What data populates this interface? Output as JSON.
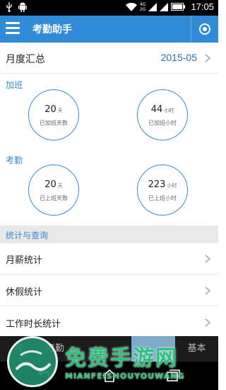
{
  "status_bar": {
    "network_labels": [
      "4G",
      "2G"
    ],
    "time": "17:05"
  },
  "app_bar": {
    "title": "考勤助手"
  },
  "month_summary": {
    "label": "月度汇总",
    "value": "2015-05"
  },
  "overtime": {
    "section_label": "加班",
    "days": {
      "value": "20",
      "unit": "天",
      "caption": "已加班天数"
    },
    "hours": {
      "value": "44",
      "unit": "小时",
      "caption": "已加班小时"
    }
  },
  "attendance": {
    "section_label": "考勤",
    "days": {
      "value": "20",
      "unit": "天",
      "caption": "已上班天数"
    },
    "hours": {
      "value": "223",
      "unit": "小时",
      "caption": "已上班小时"
    }
  },
  "stats": {
    "header": "统计与查询",
    "items": [
      {
        "label": "月薪统计"
      },
      {
        "label": "休假统计"
      },
      {
        "label": "工作时长统计"
      }
    ]
  },
  "tab_bar": {
    "tabs": [
      "打",
      "考勤",
      "",
      "",
      "",
      "基本"
    ]
  },
  "watermark": {
    "title": "免费手游网",
    "subtitle": "MIANFEISHOUYOUWANG"
  },
  "colors": {
    "accent": "#2f8ad8",
    "section": "#3b8ad6",
    "watermark": "#2ec27e"
  }
}
